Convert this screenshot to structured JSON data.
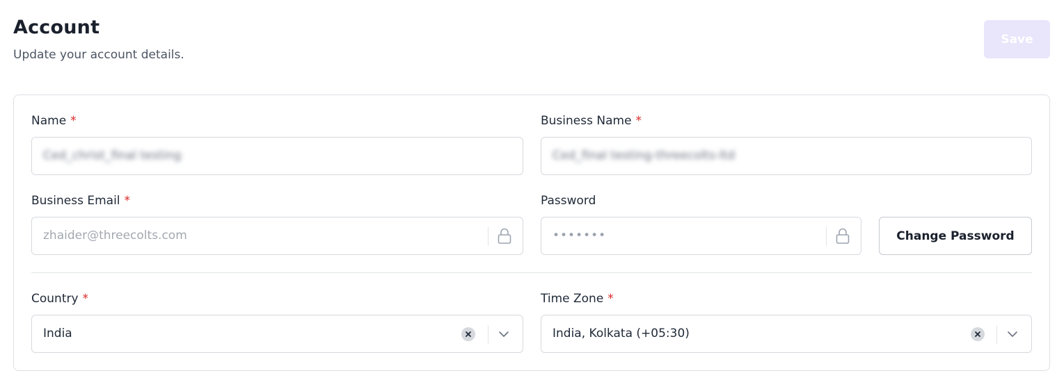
{
  "header": {
    "title": "Account",
    "subtitle": "Update your account details.",
    "save_label": "Save"
  },
  "form": {
    "name": {
      "label": "Name",
      "required_mark": "*",
      "value": "Ced_christ_final testing"
    },
    "business_name": {
      "label": "Business Name",
      "required_mark": "*",
      "value": "Ced_final testing-threecolts-ltd"
    },
    "business_email": {
      "label": "Business Email",
      "required_mark": "*",
      "value": "zhaider@threecolts.com"
    },
    "password": {
      "label": "Password",
      "value": "•••••••"
    },
    "change_password_label": "Change Password",
    "country": {
      "label": "Country",
      "required_mark": "*",
      "value": "India"
    },
    "time_zone": {
      "label": "Time Zone",
      "required_mark": "*",
      "value": "India, Kolkata (+05:30)"
    }
  },
  "icons": {
    "lock": "lock-icon",
    "clear": "clear-icon",
    "chevron": "chevron-down-icon"
  },
  "colors": {
    "save_button_bg": "#e9e5fb",
    "required": "#dc2626",
    "border": "#d6d9de"
  }
}
